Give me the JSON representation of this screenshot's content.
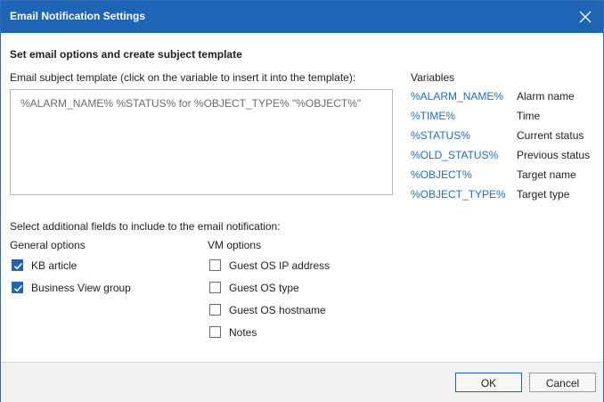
{
  "dialog": {
    "title": "Email Notification Settings",
    "close_icon": "close-icon"
  },
  "subject": {
    "section_title": "Set email options and create subject template",
    "label": "Email subject template (click on the variable to insert it into the template):",
    "value": "%ALARM_NAME% %STATUS% for %OBJECT_TYPE% \"%OBJECT%\""
  },
  "variables": {
    "title": "Variables",
    "items": [
      {
        "name": "%ALARM_NAME%",
        "desc": "Alarm name"
      },
      {
        "name": "%TIME%",
        "desc": "Time"
      },
      {
        "name": "%STATUS%",
        "desc": "Current status"
      },
      {
        "name": "%OLD_STATUS%",
        "desc": "Previous status"
      },
      {
        "name": "%OBJECT%",
        "desc": "Target name"
      },
      {
        "name": "%OBJECT_TYPE%",
        "desc": "Target type"
      }
    ]
  },
  "fields": {
    "label": "Select additional fields to include to the email notification:",
    "general": {
      "title": "General options",
      "options": [
        {
          "label": "KB article",
          "checked": true
        },
        {
          "label": "Business View group",
          "checked": true
        }
      ]
    },
    "vm": {
      "title": "VM options",
      "options": [
        {
          "label": "Guest OS IP address",
          "checked": false
        },
        {
          "label": "Guest OS type",
          "checked": false
        },
        {
          "label": "Guest OS hostname",
          "checked": false
        },
        {
          "label": "Notes",
          "checked": false
        }
      ]
    }
  },
  "footer": {
    "ok_label": "OK",
    "cancel_label": "Cancel"
  },
  "colors": {
    "titlebar": "#1f65b5",
    "link": "#1c6fc4",
    "checkbox_checked": "#1f65b5"
  }
}
